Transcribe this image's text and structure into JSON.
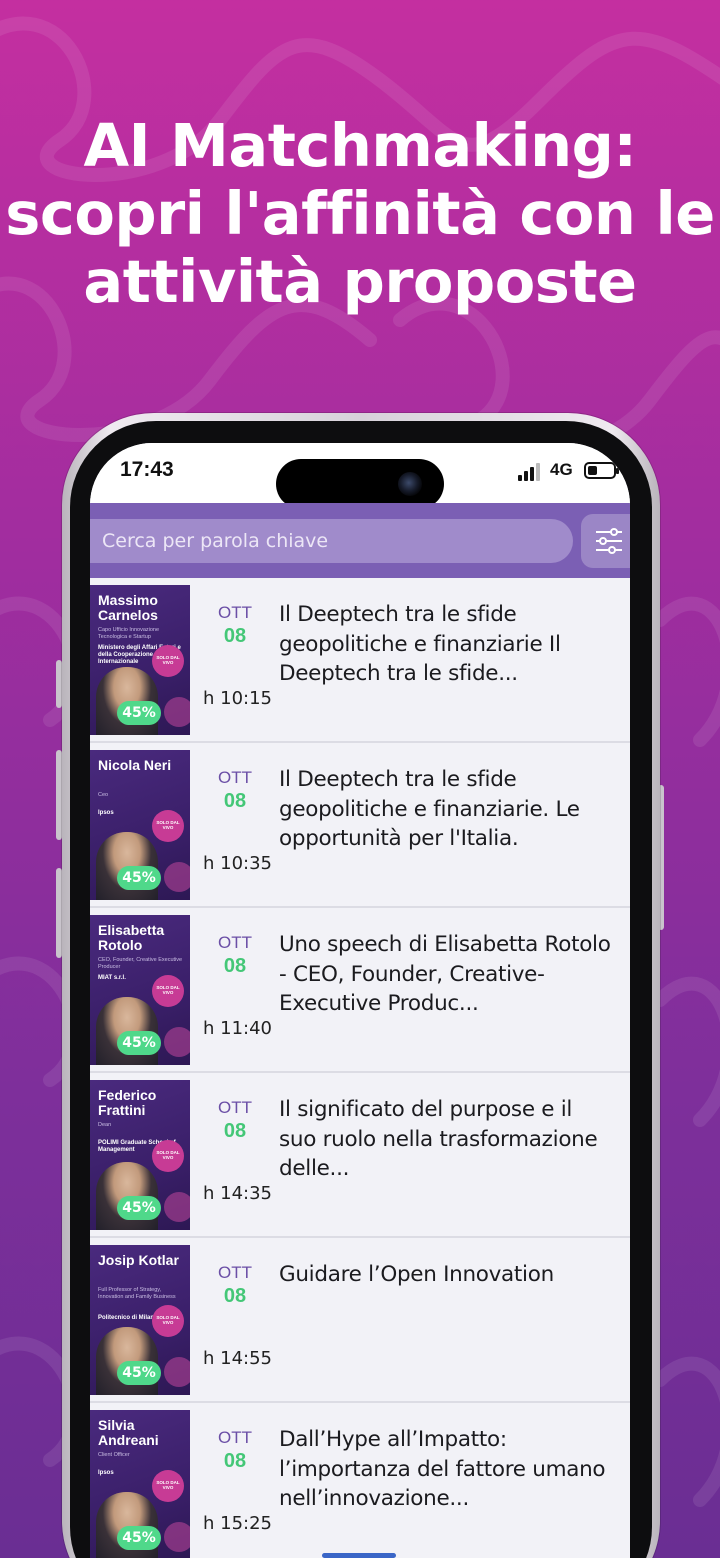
{
  "headline": "AI Matchmaking: scopri l'affinità con le attività proposte",
  "status_bar": {
    "time": "17:43",
    "network": "4G"
  },
  "search": {
    "placeholder": "Cerca per parola chiave"
  },
  "events": [
    {
      "speaker": "Massimo Carnelos",
      "role": "Capo Ufficio Innovazione Tecnologica e Startup",
      "org": "Ministero degli Affari Esteri e della Cooperazione Internazionale",
      "match": "45%",
      "month": "OTT",
      "day": "08",
      "time": "h 10:15",
      "title": "Il Deeptech tra le sfide geopolitiche e finanziarie Il Deeptech tra le sfide..."
    },
    {
      "speaker": "Nicola Neri",
      "role": "Ceo",
      "org": "Ipsos",
      "match": "45%",
      "month": "OTT",
      "day": "08",
      "time": "h 10:35",
      "title": "Il Deeptech tra le sfide geopolitiche e finanziarie. Le opportunità per l'Italia."
    },
    {
      "speaker": "Elisabetta Rotolo",
      "role": "CEO, Founder, Creative Executive Producer",
      "org": "MIAT s.r.l.",
      "match": "45%",
      "month": "OTT",
      "day": "08",
      "time": "h 11:40",
      "title": "Uno speech di Elisabetta Rotolo - CEO, Founder, Creative-Executive Produc..."
    },
    {
      "speaker": "Federico Frattini",
      "role": "Dean",
      "org": "POLIMI Graduate School of Management",
      "match": "45%",
      "month": "OTT",
      "day": "08",
      "time": "h 14:35",
      "title": "Il significato del purpose e il suo ruolo nella trasformazione delle..."
    },
    {
      "speaker": "Josip Kotlar",
      "role": "Full Professor of Strategy, Innovation and Family Business",
      "org": "Politecnico di Milano",
      "match": "45%",
      "month": "OTT",
      "day": "08",
      "time": "h 14:55",
      "title": "Guidare l’Open Innovation"
    },
    {
      "speaker": "Silvia Andreani",
      "role": "Client Officer",
      "org": "Ipsos",
      "match": "45%",
      "month": "OTT",
      "day": "08",
      "time": "h 15:25",
      "title": "Dall’Hype all’Impatto: l’importanza del fattore umano nell’innovazione..."
    }
  ],
  "stamp_text": "SOLO DAL VIVO",
  "colors": {
    "accent": "#7b5fb4",
    "match_green": "#4fd88a",
    "month_purple": "#6b4fa6"
  }
}
